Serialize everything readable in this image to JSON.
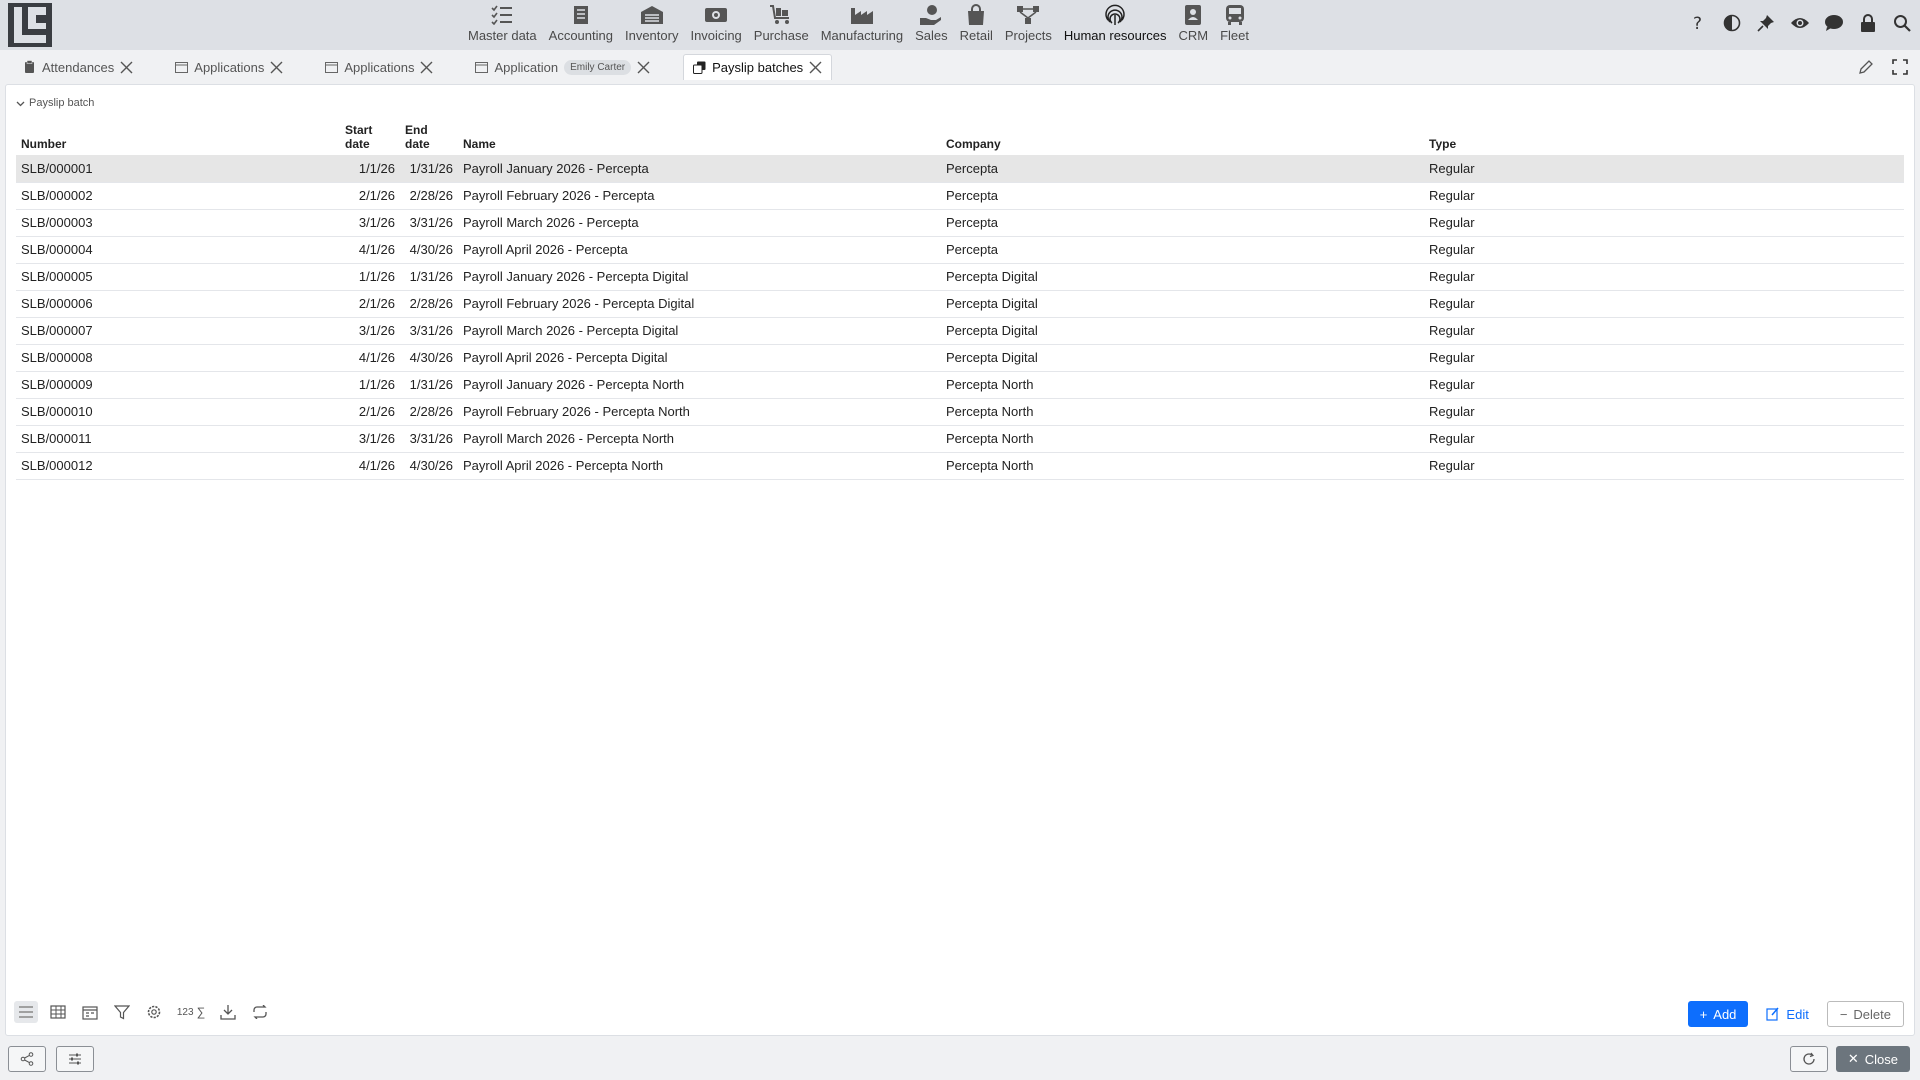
{
  "nav": {
    "modules": [
      {
        "label": "Master data",
        "icon": "checklist-icon"
      },
      {
        "label": "Accounting",
        "icon": "ledger-icon"
      },
      {
        "label": "Inventory",
        "icon": "warehouse-icon"
      },
      {
        "label": "Invoicing",
        "icon": "money-icon"
      },
      {
        "label": "Purchase",
        "icon": "cart-icon"
      },
      {
        "label": "Manufacturing",
        "icon": "factory-icon"
      },
      {
        "label": "Sales",
        "icon": "hand-coin-icon"
      },
      {
        "label": "Retail",
        "icon": "shopping-bag-icon"
      },
      {
        "label": "Projects",
        "icon": "project-tree-icon"
      },
      {
        "label": "Human resources",
        "icon": "fingerprint-icon"
      },
      {
        "label": "CRM",
        "icon": "contact-card-icon"
      },
      {
        "label": "Fleet",
        "icon": "bus-icon"
      }
    ],
    "active_module": "Human resources"
  },
  "tabs": [
    {
      "label": "Attendances",
      "icon": "clipboard-icon"
    },
    {
      "label": "Applications",
      "icon": "window-icon"
    },
    {
      "label": "Applications",
      "icon": "window-icon"
    },
    {
      "label": "Application",
      "icon": "window-icon",
      "chip": "Emily Carter"
    },
    {
      "label": "Payslip batches",
      "icon": "copy-icon",
      "active": true
    }
  ],
  "section": {
    "title": "Payslip batch"
  },
  "table": {
    "headers": {
      "number": "Number",
      "start_date_1": "Start",
      "start_date_2": "date",
      "end_date": "End date",
      "name": "Name",
      "company": "Company",
      "type": "Type"
    },
    "rows": [
      {
        "number": "SLB/000001",
        "start": "1/1/26",
        "end": "1/31/26",
        "name": "Payroll January 2026 - Percepta",
        "company": "Percepta",
        "type": "Regular"
      },
      {
        "number": "SLB/000002",
        "start": "2/1/26",
        "end": "2/28/26",
        "name": "Payroll February 2026 - Percepta",
        "company": "Percepta",
        "type": "Regular"
      },
      {
        "number": "SLB/000003",
        "start": "3/1/26",
        "end": "3/31/26",
        "name": "Payroll March 2026 - Percepta",
        "company": "Percepta",
        "type": "Regular"
      },
      {
        "number": "SLB/000004",
        "start": "4/1/26",
        "end": "4/30/26",
        "name": "Payroll April 2026 - Percepta",
        "company": "Percepta",
        "type": "Regular"
      },
      {
        "number": "SLB/000005",
        "start": "1/1/26",
        "end": "1/31/26",
        "name": "Payroll January 2026 - Percepta Digital",
        "company": "Percepta Digital",
        "type": "Regular"
      },
      {
        "number": "SLB/000006",
        "start": "2/1/26",
        "end": "2/28/26",
        "name": "Payroll February 2026 - Percepta Digital",
        "company": "Percepta Digital",
        "type": "Regular"
      },
      {
        "number": "SLB/000007",
        "start": "3/1/26",
        "end": "3/31/26",
        "name": "Payroll March 2026 - Percepta Digital",
        "company": "Percepta Digital",
        "type": "Regular"
      },
      {
        "number": "SLB/000008",
        "start": "4/1/26",
        "end": "4/30/26",
        "name": "Payroll April 2026 - Percepta Digital",
        "company": "Percepta Digital",
        "type": "Regular"
      },
      {
        "number": "SLB/000009",
        "start": "1/1/26",
        "end": "1/31/26",
        "name": "Payroll January 2026 - Percepta North",
        "company": "Percepta North",
        "type": "Regular"
      },
      {
        "number": "SLB/000010",
        "start": "2/1/26",
        "end": "2/28/26",
        "name": "Payroll February 2026 - Percepta North",
        "company": "Percepta North",
        "type": "Regular"
      },
      {
        "number": "SLB/000011",
        "start": "3/1/26",
        "end": "3/31/26",
        "name": "Payroll March 2026 - Percepta North",
        "company": "Percepta North",
        "type": "Regular"
      },
      {
        "number": "SLB/000012",
        "start": "4/1/26",
        "end": "4/30/26",
        "name": "Payroll April 2026 - Percepta North",
        "company": "Percepta North",
        "type": "Regular"
      }
    ],
    "selected_row": 0
  },
  "toolbar": {
    "sum_label": "123",
    "add_label": "Add",
    "edit_label": "Edit",
    "delete_label": "Delete"
  },
  "footer": {
    "close_label": "Close"
  },
  "colors": {
    "accent": "#0d6efd",
    "selected_row": "#e6e6e6",
    "close_button": "#6c757d"
  }
}
